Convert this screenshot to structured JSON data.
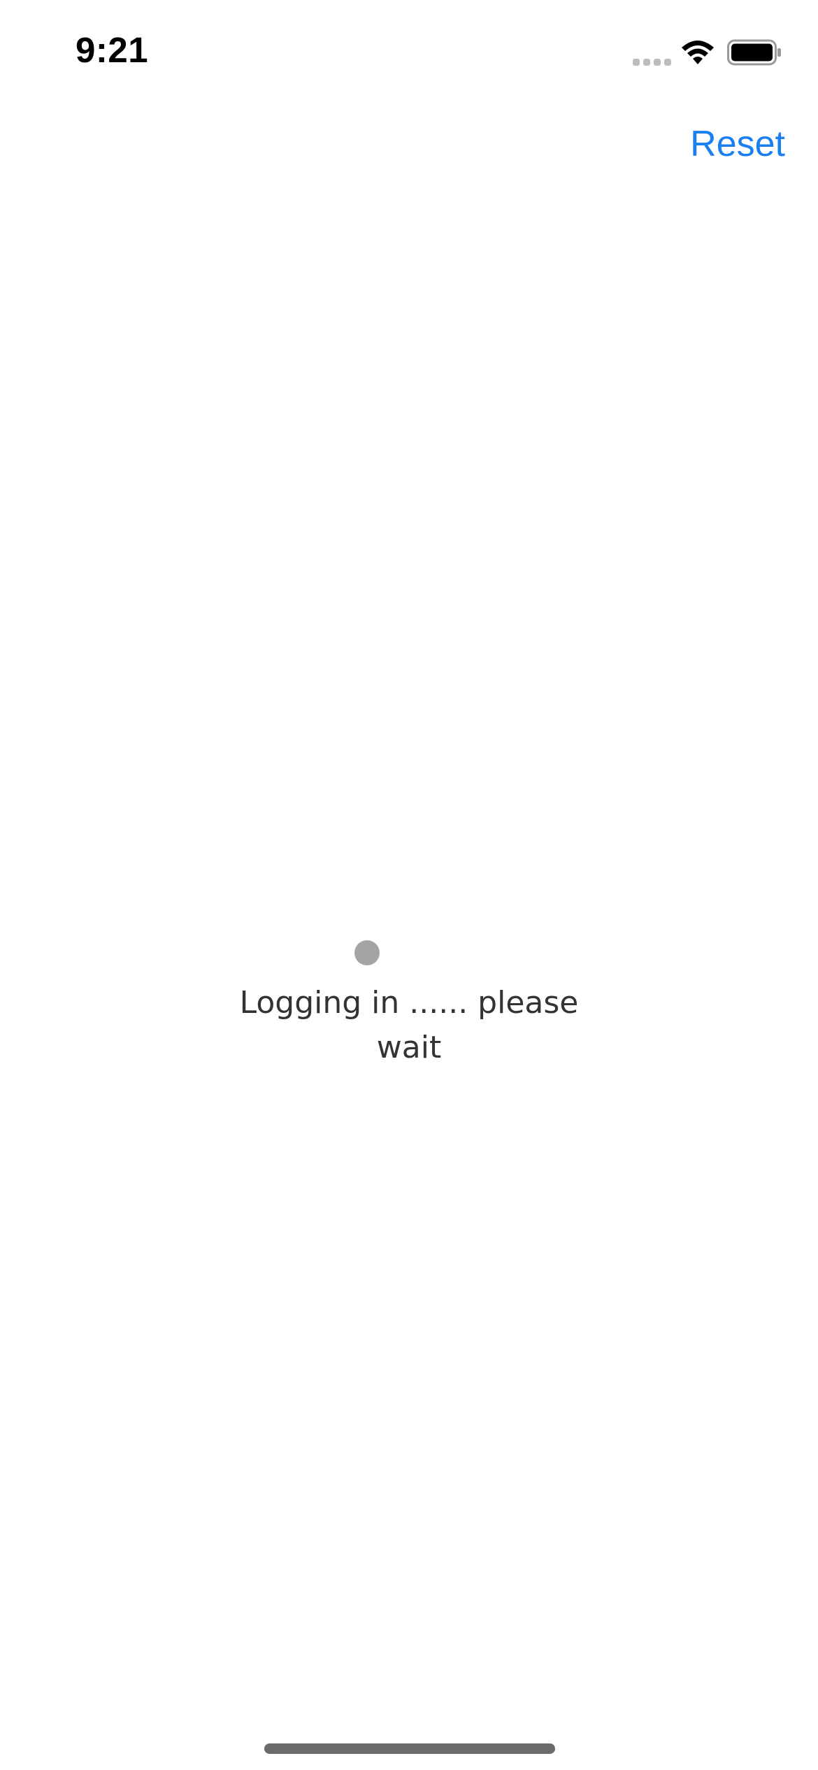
{
  "status_bar": {
    "time": "9:21",
    "icons": [
      "signal-icon",
      "wifi-icon",
      "battery-icon"
    ]
  },
  "header": {
    "reset_label": "Reset"
  },
  "loading": {
    "message": "Logging in ...... please wait"
  },
  "colors": {
    "accent": "#1a7ff0",
    "spinner": "#a4a4a4",
    "text": "#333333",
    "background": "#ffffff"
  }
}
